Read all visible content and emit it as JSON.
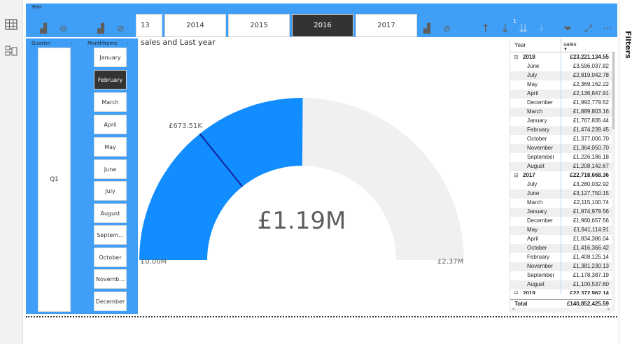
{
  "year_slicer": {
    "title": "Year",
    "tiles": [
      {
        "label": "13",
        "selected": false
      },
      {
        "label": "2014",
        "selected": false
      },
      {
        "label": "2015",
        "selected": false
      },
      {
        "label": "2016",
        "selected": true
      },
      {
        "label": "2017",
        "selected": false
      }
    ],
    "page_indicator": "1"
  },
  "quarter_slicer": {
    "title": "Quarter",
    "value": "Q1"
  },
  "month_slicer": {
    "title": "MonthName",
    "items": [
      {
        "label": "January",
        "selected": false
      },
      {
        "label": "February",
        "selected": true
      },
      {
        "label": "March",
        "selected": false
      },
      {
        "label": "April",
        "selected": false
      },
      {
        "label": "May",
        "selected": false
      },
      {
        "label": "June",
        "selected": false
      },
      {
        "label": "July",
        "selected": false
      },
      {
        "label": "August",
        "selected": false
      },
      {
        "label": "Septem...",
        "selected": false
      },
      {
        "label": "October",
        "selected": false
      },
      {
        "label": "Novemb...",
        "selected": false
      },
      {
        "label": "December",
        "selected": false
      }
    ]
  },
  "gauge": {
    "title": "sales and Last year",
    "center_label": "£1.19M",
    "min_label": "£0.00M",
    "max_label": "£2.37M",
    "target_label": "£673.51K",
    "value": 1.19,
    "min": 0,
    "max": 2.37,
    "target": 0.67351,
    "fill_color": "#118dff",
    "track_color": "#f0f0f0",
    "target_color": "#12239e"
  },
  "matrix": {
    "col_year": "Year",
    "col_sales": "sales",
    "groups": [
      {
        "year": "2018",
        "total": "£23,221,134.55",
        "rows": [
          {
            "month": "June",
            "value": "£3,596,037.82"
          },
          {
            "month": "July",
            "value": "£2,819,042.78"
          },
          {
            "month": "May",
            "value": "£2,369,162.22"
          },
          {
            "month": "April",
            "value": "£2,136,847.91"
          },
          {
            "month": "December",
            "value": "£1,992,779.52"
          },
          {
            "month": "March",
            "value": "£1,889,803.16"
          },
          {
            "month": "January",
            "value": "£1,767,835.44"
          },
          {
            "month": "February",
            "value": "£1,474,239.45"
          },
          {
            "month": "October",
            "value": "£1,377,006.70"
          },
          {
            "month": "November",
            "value": "£1,364,050.70"
          },
          {
            "month": "September",
            "value": "£1,226,186.18"
          },
          {
            "month": "August",
            "value": "£1,208,142.67"
          }
        ]
      },
      {
        "year": "2017",
        "total": "£22,718,668.36",
        "rows": [
          {
            "month": "July",
            "value": "£3,280,032.92"
          },
          {
            "month": "June",
            "value": "£3,127,750.15"
          },
          {
            "month": "March",
            "value": "£2,115,100.74"
          },
          {
            "month": "January",
            "value": "£1,974,979.56"
          },
          {
            "month": "December",
            "value": "£1,960,657.56"
          },
          {
            "month": "May",
            "value": "£1,941,114.91"
          },
          {
            "month": "April",
            "value": "£1,834,386.04"
          },
          {
            "month": "October",
            "value": "£1,416,366.42"
          },
          {
            "month": "February",
            "value": "£1,408,125.14"
          },
          {
            "month": "November",
            "value": "£1,381,230.13"
          },
          {
            "month": "September",
            "value": "£1,178,387.19"
          },
          {
            "month": "August",
            "value": "£1,100,537.60"
          }
        ]
      }
    ],
    "partial_group": {
      "year": "2019",
      "total": "£22,372,962.14"
    },
    "total_label": "Total",
    "total_value": "£140,852,425.59"
  },
  "filters_label": "Filters",
  "icons": [
    "table-icon",
    "model-icon",
    "drill-icon",
    "no-entry-icon",
    "arrow-up-icon",
    "arrow-down-icon",
    "expand-icon",
    "filter-icon",
    "focus-mode-icon",
    "more-options-icon"
  ]
}
